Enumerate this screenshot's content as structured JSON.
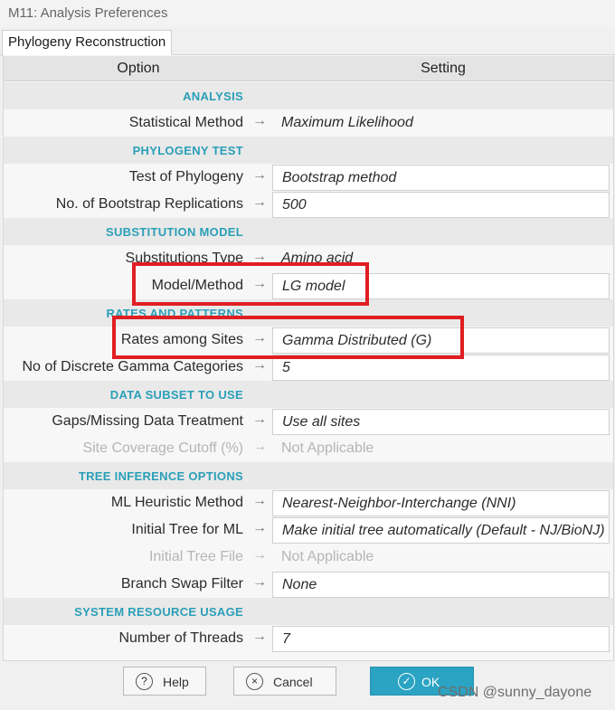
{
  "window": {
    "title": "M11: Analysis Preferences"
  },
  "tab": {
    "label": "Phylogeny Reconstruction"
  },
  "header": {
    "option": "Option",
    "setting": "Setting"
  },
  "arrow_glyph": "→",
  "sections": {
    "analysis": "ANALYSIS",
    "phylogeny_test": "PHYLOGENY TEST",
    "substitution_model": "SUBSTITUTION MODEL",
    "rates_patterns": "RATES AND PATTERNS",
    "data_subset": "DATA SUBSET TO USE",
    "tree_inference": "TREE INFERENCE OPTIONS",
    "system_resource": "SYSTEM RESOURCE USAGE"
  },
  "rows": {
    "statistical_method": {
      "label": "Statistical Method",
      "value": "Maximum Likelihood"
    },
    "test_of_phylogeny": {
      "label": "Test of Phylogeny",
      "value": "Bootstrap method"
    },
    "bootstrap_replications": {
      "label": "No. of Bootstrap Replications",
      "value": "500"
    },
    "substitutions_type": {
      "label": "Substitutions Type",
      "value": "Amino acid"
    },
    "model_method": {
      "label": "Model/Method",
      "value": "LG model"
    },
    "rates_among_sites": {
      "label": "Rates among Sites",
      "value": "Gamma Distributed (G)"
    },
    "gamma_categories": {
      "label": "No of Discrete Gamma Categories",
      "value": "5"
    },
    "gaps_missing": {
      "label": "Gaps/Missing Data Treatment",
      "value": "Use all sites"
    },
    "site_coverage": {
      "label": "Site Coverage Cutoff (%)",
      "value": "Not Applicable"
    },
    "ml_heuristic": {
      "label": "ML Heuristic Method",
      "value": "Nearest-Neighbor-Interchange (NNI)"
    },
    "initial_tree_ml": {
      "label": "Initial Tree for ML",
      "value": "Make initial tree automatically (Default - NJ/BioNJ)"
    },
    "initial_tree_file": {
      "label": "Initial Tree File",
      "value": "Not Applicable"
    },
    "branch_swap": {
      "label": "Branch Swap Filter",
      "value": "None"
    },
    "threads": {
      "label": "Number of Threads",
      "value": "7"
    }
  },
  "buttons": {
    "help": {
      "label": "Help",
      "icon": "?"
    },
    "cancel": {
      "label": "Cancel",
      "icon": "×"
    },
    "ok": {
      "label": "OK",
      "icon": "✓"
    }
  },
  "watermark": "CSDN @sunny_dayone",
  "colors": {
    "section_text": "#2a9fb8",
    "highlight": "#e01e22",
    "ok_button": "#2ba3c3"
  }
}
